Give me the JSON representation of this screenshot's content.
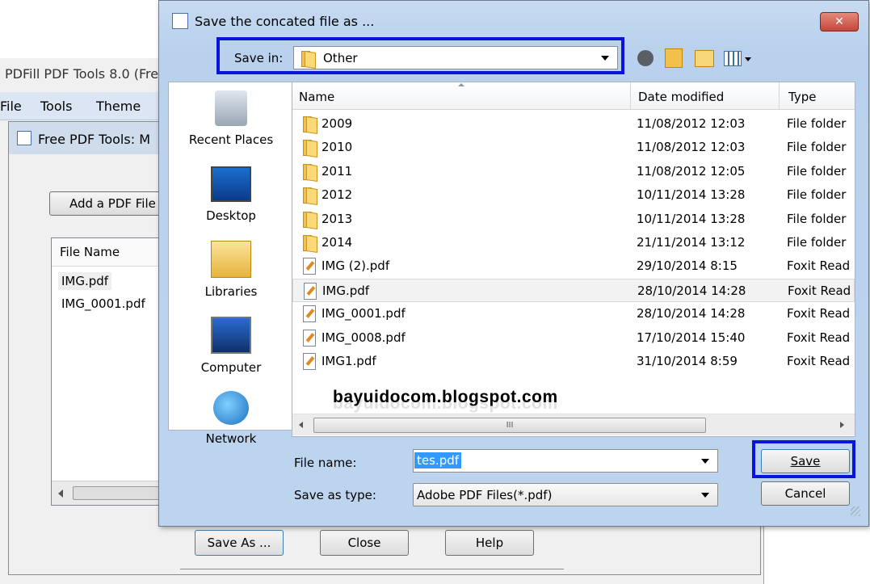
{
  "background_app": {
    "title": "PDFill PDF Tools 8.0 (Fre",
    "menu": [
      "File",
      "Tools",
      "Theme"
    ],
    "child_window_title": "Free PDF Tools: M",
    "add_button": "Add a PDF File",
    "file_list_header": "File Name",
    "file_list": [
      "IMG.pdf",
      "IMG_0001.pdf"
    ],
    "bottom_buttons": {
      "save_as": "Save As ...",
      "close": "Close",
      "help": "Help"
    }
  },
  "dialog": {
    "title": "Save the concated file as ...",
    "close_glyph": "✕",
    "save_in_label": "Save in:",
    "save_in_value": "Other",
    "places": [
      "Recent Places",
      "Desktop",
      "Libraries",
      "Computer",
      "Network"
    ],
    "columns": {
      "name": "Name",
      "date": "Date modified",
      "type": "Type"
    },
    "files": [
      {
        "name": "2009",
        "date": "11/08/2012 12:03",
        "type": "File folder",
        "icon": "folder"
      },
      {
        "name": "2010",
        "date": "11/08/2012 12:03",
        "type": "File folder",
        "icon": "folder"
      },
      {
        "name": "2011",
        "date": "11/08/2012 12:05",
        "type": "File folder",
        "icon": "folder"
      },
      {
        "name": "2012",
        "date": "10/11/2014 13:28",
        "type": "File folder",
        "icon": "folder"
      },
      {
        "name": "2013",
        "date": "10/11/2014 13:28",
        "type": "File folder",
        "icon": "folder"
      },
      {
        "name": "2014",
        "date": "21/11/2014 13:12",
        "type": "File folder",
        "icon": "folder"
      },
      {
        "name": "IMG (2).pdf",
        "date": "29/10/2014 8:15",
        "type": "Foxit Read",
        "icon": "pdf"
      },
      {
        "name": "IMG.pdf",
        "date": "28/10/2014 14:28",
        "type": "Foxit Read",
        "icon": "pdf"
      },
      {
        "name": "IMG_0001.pdf",
        "date": "28/10/2014 14:28",
        "type": "Foxit Read",
        "icon": "pdf"
      },
      {
        "name": "IMG_0008.pdf",
        "date": "17/10/2014 15:40",
        "type": "Foxit Read",
        "icon": "pdf"
      },
      {
        "name": "IMG1.pdf",
        "date": "31/10/2014 8:59",
        "type": "Foxit Read",
        "icon": "pdf"
      }
    ],
    "highlighted_row": 7,
    "watermark": "bayuidocom.blogspot.com",
    "scroll_mid": "III",
    "file_name_label": "File name:",
    "file_name_value": "tes.pdf",
    "save_type_label": "Save as type:",
    "save_type_value": "Adobe PDF Files(*.pdf)",
    "save_button": "Save",
    "cancel_button": "Cancel"
  },
  "colors": {
    "highlight_box": "#0a14d8",
    "title_bar": "#bcd4ee",
    "close_red": "#c4463a",
    "selection": "#3399ff"
  }
}
